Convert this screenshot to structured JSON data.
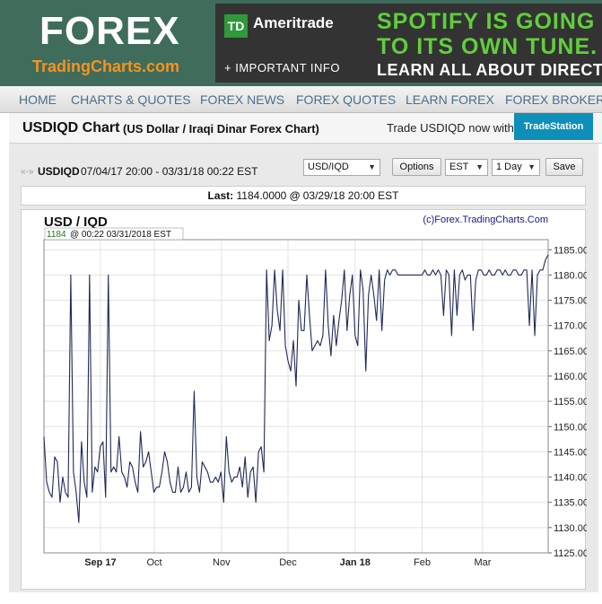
{
  "header": {
    "logo_title": "FOREX",
    "logo_subtitle": "TradingCharts.com",
    "ad": {
      "badge": "TD",
      "brand": "Ameritrade",
      "info": "+ IMPORTANT INFO",
      "line1": "SPOTIFY IS GOING IT",
      "line2": "TO ITS OWN TUNE.",
      "line3": "LEARN ALL ABOUT DIRECT LIS"
    }
  },
  "nav": {
    "items": [
      "HOME",
      "CHARTS & QUOTES",
      "FOREX NEWS",
      "FOREX QUOTES",
      "LEARN FOREX",
      "FOREX BROKER RE"
    ]
  },
  "titlebar": {
    "title": "USDIQD Chart",
    "subtitle": "(US Dollar / Iraqi Dinar Forex Chart)",
    "trade_text": "Trade USDIQD now with:",
    "broker": "TradeStation"
  },
  "controls": {
    "arrows": "«-»",
    "symbol": "USDIQD",
    "range": "07/04/17 20:00 - 03/31/18 00:22 EST",
    "pair_select": "USD/IQD",
    "options_button": "Options",
    "tz_select": "EST",
    "interval_select": "1 Day",
    "save_button": "Save"
  },
  "last": {
    "label": "Last:",
    "value": "1184.0000",
    "at": "@",
    "time": "03/29/18 20:00 EST"
  },
  "chart_data": {
    "type": "line",
    "title": "USD / IQD",
    "credit": "(c)Forex.TradingCharts.Com",
    "readout_value": "1184",
    "readout_time": "@ 00:22 03/31/2018 EST",
    "ylim": [
      1125,
      1187
    ],
    "yticks": [
      "1125.00",
      "1130.00",
      "1135.00",
      "1140.00",
      "1145.00",
      "1150.00",
      "1155.00",
      "1160.00",
      "1165.00",
      "1170.00",
      "1175.00",
      "1180.00",
      "1185.00"
    ],
    "xticks": [
      {
        "label": "Sep 17",
        "t": 0.112
      },
      {
        "label": "Oct",
        "t": 0.219
      },
      {
        "label": "Nov",
        "t": 0.352
      },
      {
        "label": "Dec",
        "t": 0.484
      },
      {
        "label": "Jan 18",
        "t": 0.617
      },
      {
        "label": "Feb",
        "t": 0.75
      },
      {
        "label": "Mar",
        "t": 0.87
      }
    ],
    "grid": true,
    "series": [
      {
        "color": "#1f2a5a",
        "values": [
          1148,
          1139,
          1137,
          1136,
          1144,
          1143,
          1135,
          1140,
          1137,
          1136,
          1180,
          1141,
          1137,
          1131,
          1147,
          1139,
          1136,
          1180,
          1137,
          1142,
          1141,
          1146,
          1147,
          1136,
          1180,
          1141,
          1142,
          1141,
          1148,
          1141,
          1140,
          1138,
          1143,
          1142,
          1139,
          1137,
          1149,
          1142,
          1143,
          1145,
          1141,
          1137,
          1138,
          1138,
          1141,
          1145,
          1143,
          1139,
          1137,
          1137,
          1142,
          1137,
          1138,
          1141,
          1137,
          1138,
          1157,
          1140,
          1137,
          1143,
          1142,
          1141,
          1139,
          1139,
          1140,
          1139,
          1141,
          1135,
          1148,
          1141,
          1139,
          1140,
          1140,
          1142,
          1138,
          1144,
          1136,
          1141,
          1142,
          1135,
          1145,
          1146,
          1141,
          1181,
          1167,
          1170,
          1181,
          1173,
          1169,
          1181,
          1166,
          1163,
          1161,
          1167,
          1158,
          1175,
          1169,
          1169,
          1180,
          1172,
          1165,
          1166,
          1167,
          1166,
          1168,
          1181,
          1170,
          1164,
          1172,
          1166,
          1171,
          1175,
          1181,
          1169,
          1176,
          1180,
          1168,
          1166,
          1181,
          1177,
          1161,
          1176,
          1180,
          1176,
          1171,
          1181,
          1169,
          1179,
          1181,
          1180,
          1181,
          1181,
          1180,
          1180,
          1180,
          1180,
          1180,
          1180,
          1180,
          1180,
          1180,
          1180,
          1181,
          1180,
          1180,
          1181,
          1180,
          1181,
          1180,
          1172,
          1181,
          1180,
          1168,
          1181,
          1172,
          1180,
          1181,
          1179,
          1180,
          1180,
          1169,
          1179,
          1181,
          1181,
          1180,
          1180,
          1181,
          1180,
          1180,
          1181,
          1181,
          1180,
          1181,
          1180,
          1180,
          1181,
          1181,
          1180,
          1180,
          1181,
          1181,
          1170,
          1181,
          1168,
          1180,
          1181,
          1181,
          1183,
          1184
        ]
      }
    ]
  }
}
